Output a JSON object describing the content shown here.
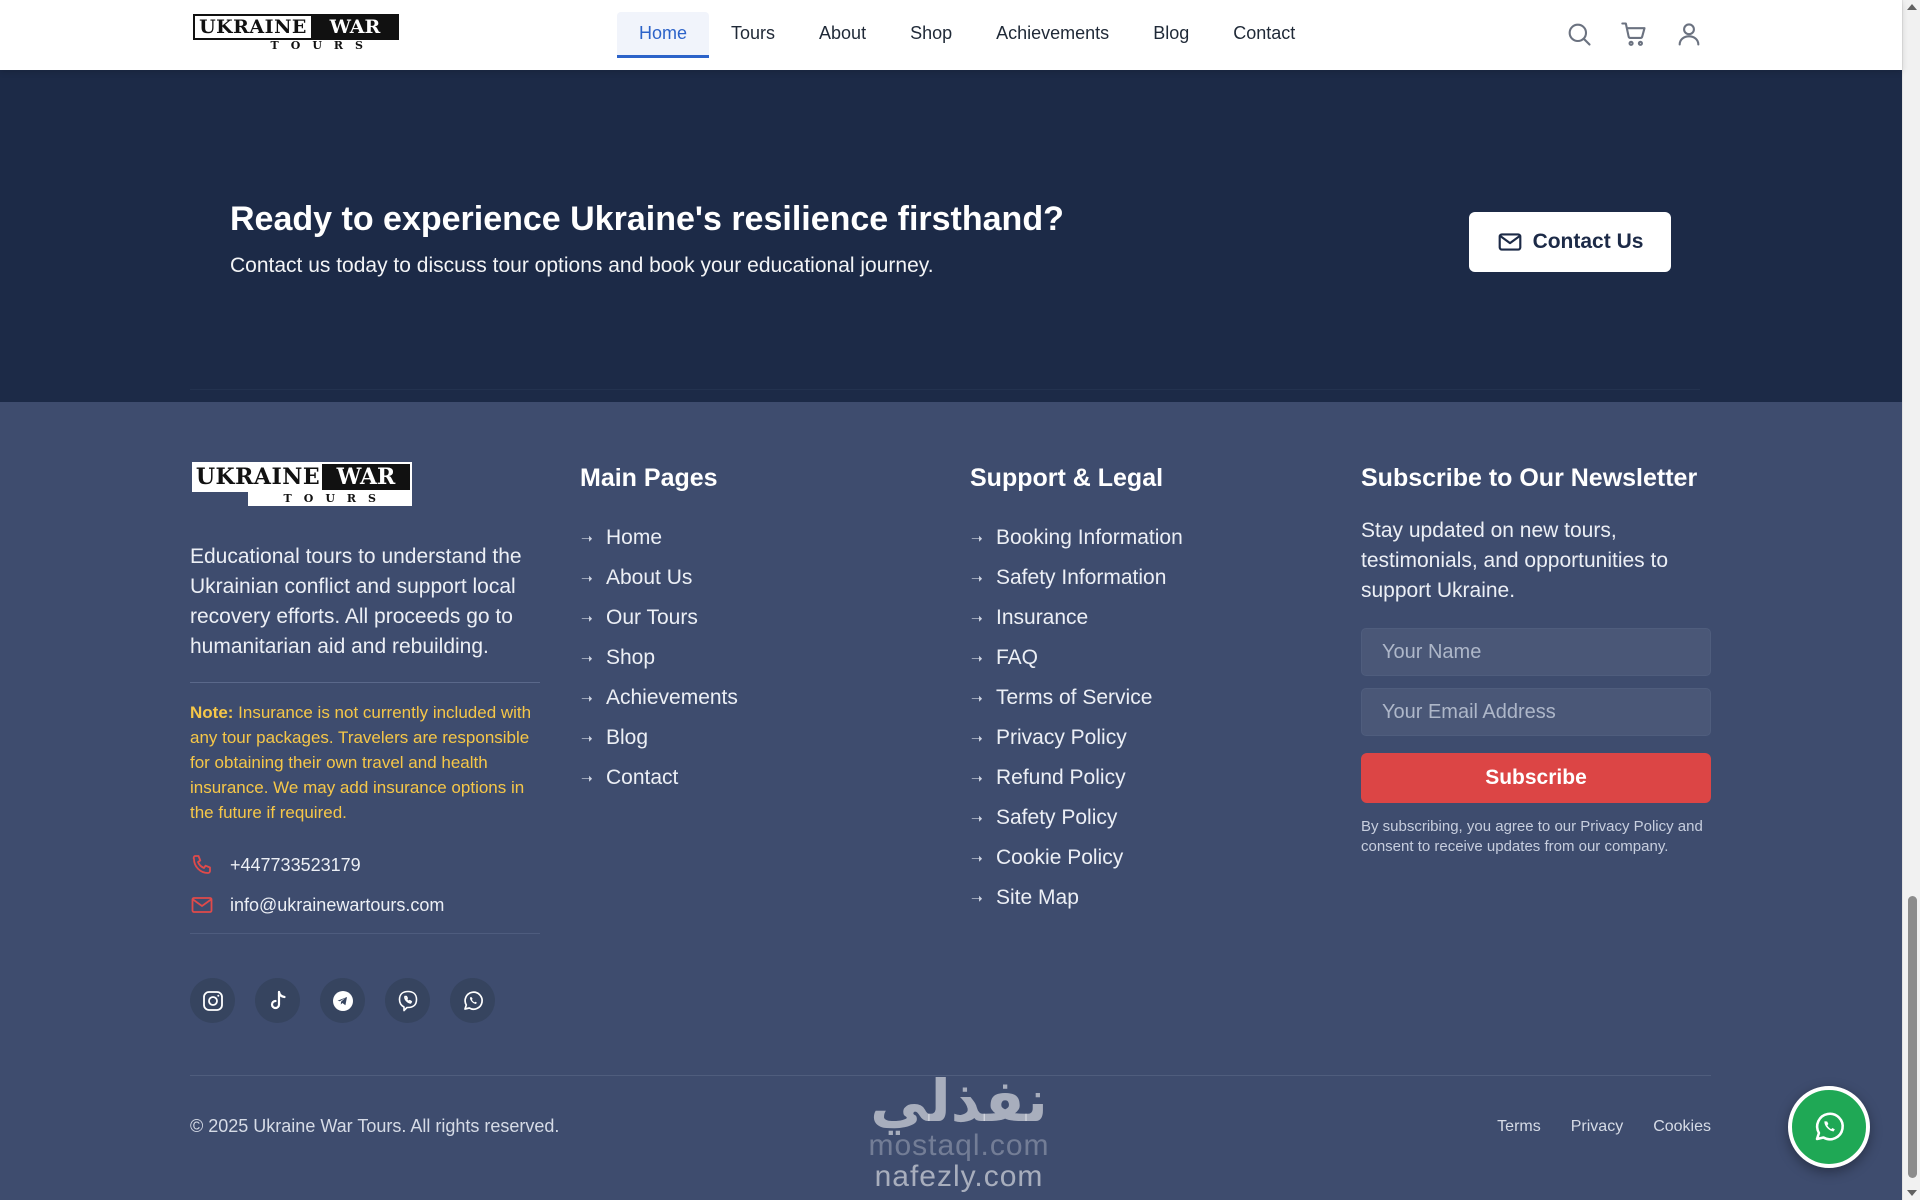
{
  "nav": {
    "logo": {
      "word1": "UKRAINE",
      "word2": "WAR",
      "word3": "TOURS"
    },
    "links": [
      {
        "label": "Home",
        "active": true
      },
      {
        "label": "Tours"
      },
      {
        "label": "About"
      },
      {
        "label": "Shop"
      },
      {
        "label": "Achievements"
      },
      {
        "label": "Blog"
      },
      {
        "label": "Contact"
      }
    ],
    "icons": [
      "search-icon",
      "cart-icon",
      "user-icon"
    ]
  },
  "cta": {
    "title": "Ready to experience Ukraine's resilience firsthand?",
    "subtitle": "Contact us today to discuss tour options and book your educational journey.",
    "button": {
      "label": "Contact Us",
      "icon": "mail-icon"
    }
  },
  "footer": {
    "logo": {
      "word1": "UKRAINE",
      "word2": "WAR",
      "word3": "TOURS"
    },
    "description": "Educational tours to understand the Ukrainian conflict and support local recovery efforts. All proceeds go to humanitarian aid and rebuilding.",
    "note": {
      "label": "Note:",
      "text": " Insurance is not currently included with any tour packages. Travelers are responsible for obtaining their own travel and health insurance. We may add insurance options in the future if required."
    },
    "phone": "+447733523179",
    "email": "info@ukrainewartours.com",
    "socials": [
      "instagram-icon",
      "tiktok-icon",
      "telegram-icon",
      "viber-icon",
      "whatsapp-icon"
    ],
    "main_pages": {
      "title": "Main Pages",
      "items": [
        "Home",
        "About Us",
        "Our Tours",
        "Shop",
        "Achievements",
        "Blog",
        "Contact"
      ]
    },
    "support_legal": {
      "title": "Support & Legal",
      "items": [
        "Booking Information",
        "Safety Information",
        "Insurance",
        "FAQ",
        "Terms of Service",
        "Privacy Policy",
        "Refund Policy",
        "Safety Policy",
        "Cookie Policy",
        "Site Map"
      ]
    },
    "newsletter": {
      "title": "Subscribe to Our Newsletter",
      "description": "Stay updated on new tours, testimonials, and opportunities to support Ukraine.",
      "name_placeholder": "Your Name",
      "email_placeholder": "Your Email Address",
      "button": "Subscribe",
      "legal": "By subscribing, you agree to our Privacy Policy and consent to receive updates from our company."
    },
    "copyright": "© 2025 Ukraine War Tours. All rights reserved.",
    "bottom_links": [
      "Terms",
      "Privacy",
      "Cookies"
    ]
  },
  "watermark": {
    "arabic": "نفذلي",
    "line1": "mostaql.com",
    "line2": "nafezly.com"
  },
  "colors": {
    "cta_bg": "#1c2a47",
    "footer_bg": "#3e4c6e",
    "accent_red": "#dc4545",
    "note_yellow": "#f6c748",
    "nav_active": "#2c63c9",
    "whatsapp_green": "#1fa855"
  }
}
